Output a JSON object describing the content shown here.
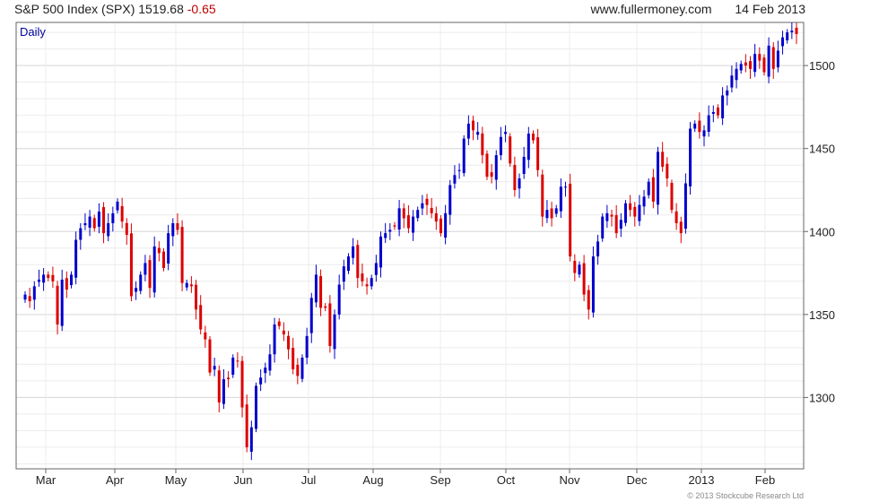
{
  "header": {
    "symbol": "S&P 500 Index (SPX)",
    "last": "1519.68",
    "change": "-0.65",
    "site": "www.fullermoney.com",
    "date": "14 Feb 2013"
  },
  "copyright": "© 2013 Stockcube Research Ltd",
  "colors": {
    "up": "#0000cc",
    "down": "#dd0000",
    "grid": "#d9d9d9",
    "frame": "#666666",
    "label": "#000099"
  },
  "chart_data": {
    "type": "candlestick",
    "period_label": "Daily",
    "ylim": [
      1257,
      1526
    ],
    "yticks": [
      1300,
      1350,
      1400,
      1450,
      1500
    ],
    "axis_side": "right",
    "month_labels": [
      "Mar",
      "Apr",
      "May",
      "Jun",
      "Jul",
      "Aug",
      "Sep",
      "Oct",
      "Nov",
      "Dec",
      "2013",
      "Feb"
    ],
    "close": [
      1362,
      1358,
      1367,
      1371,
      1374,
      1372,
      1370,
      1344,
      1371,
      1365,
      1374,
      1395,
      1402,
      1405,
      1409,
      1402,
      1412,
      1399,
      1405,
      1411,
      1418,
      1406,
      1398,
      1361,
      1366,
      1374,
      1381,
      1366,
      1391,
      1387,
      1378,
      1399,
      1405,
      1401,
      1369,
      1369,
      1367,
      1353,
      1341,
      1335,
      1315,
      1319,
      1297,
      1311,
      1311,
      1324,
      1322,
      1294,
      1270,
      1282,
      1307,
      1312,
      1318,
      1326,
      1344,
      1343,
      1338,
      1329,
      1317,
      1313,
      1324,
      1337,
      1360,
      1374,
      1354,
      1354,
      1331,
      1350,
      1368,
      1379,
      1385,
      1391,
      1372,
      1370,
      1367,
      1372,
      1381,
      1397,
      1399,
      1401,
      1403,
      1414,
      1408,
      1402,
      1409,
      1413,
      1417,
      1416,
      1411,
      1406,
      1399,
      1411,
      1428,
      1434,
      1437,
      1456,
      1465,
      1461,
      1460,
      1446,
      1433,
      1433,
      1446,
      1457,
      1460,
      1441,
      1425,
      1432,
      1445,
      1459,
      1455,
      1437,
      1409,
      1413,
      1408,
      1414,
      1427,
      1427,
      1385,
      1375,
      1380,
      1362,
      1353,
      1385,
      1394,
      1409,
      1411,
      1409,
      1399,
      1407,
      1417,
      1413,
      1409,
      1416,
      1421,
      1430,
      1418,
      1448,
      1439,
      1432,
      1413,
      1405,
      1399,
      1429,
      1462,
      1465,
      1460,
      1461,
      1470,
      1472,
      1470,
      1482,
      1485,
      1494,
      1498,
      1501,
      1500,
      1498,
      1507,
      1503,
      1496,
      1512,
      1498,
      1509,
      1517,
      1520,
      1521,
      1519
    ]
  }
}
